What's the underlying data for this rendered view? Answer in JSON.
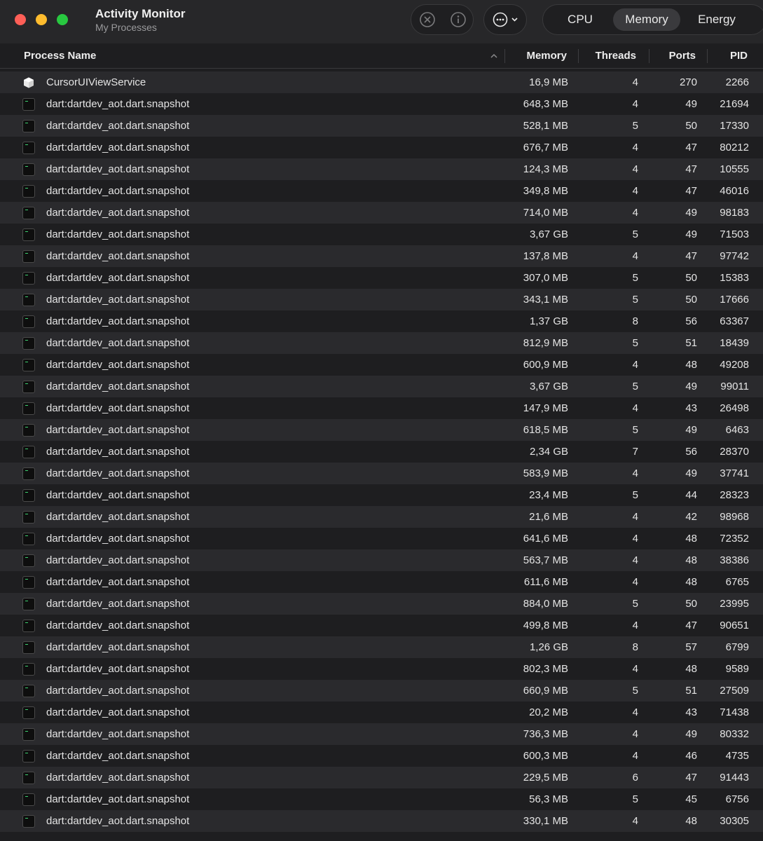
{
  "window": {
    "title": "Activity Monitor",
    "subtitle": "My Processes"
  },
  "toolbar": {
    "tabs": [
      "CPU",
      "Memory",
      "Energy"
    ],
    "selected_tab": "Memory",
    "stop_icon": "stop-process-icon",
    "info_icon": "info-icon",
    "more_icon": "more-options-icon"
  },
  "columns": {
    "name": "Process Name",
    "memory": "Memory",
    "threads": "Threads",
    "ports": "Ports",
    "pid": "PID"
  },
  "processes": [
    {
      "name": "CursorUIViewService",
      "memory": "16,9 MB",
      "threads": "4",
      "ports": "270",
      "pid": "2266",
      "icon": "cube-icon"
    },
    {
      "name": "dart:dartdev_aot.dart.snapshot",
      "memory": "648,3 MB",
      "threads": "4",
      "ports": "49",
      "pid": "21694",
      "icon": "terminal-icon"
    },
    {
      "name": "dart:dartdev_aot.dart.snapshot",
      "memory": "528,1 MB",
      "threads": "5",
      "ports": "50",
      "pid": "17330",
      "icon": "terminal-icon"
    },
    {
      "name": "dart:dartdev_aot.dart.snapshot",
      "memory": "676,7 MB",
      "threads": "4",
      "ports": "47",
      "pid": "80212",
      "icon": "terminal-icon"
    },
    {
      "name": "dart:dartdev_aot.dart.snapshot",
      "memory": "124,3 MB",
      "threads": "4",
      "ports": "47",
      "pid": "10555",
      "icon": "terminal-icon"
    },
    {
      "name": "dart:dartdev_aot.dart.snapshot",
      "memory": "349,8 MB",
      "threads": "4",
      "ports": "47",
      "pid": "46016",
      "icon": "terminal-icon"
    },
    {
      "name": "dart:dartdev_aot.dart.snapshot",
      "memory": "714,0 MB",
      "threads": "4",
      "ports": "49",
      "pid": "98183",
      "icon": "terminal-icon"
    },
    {
      "name": "dart:dartdev_aot.dart.snapshot",
      "memory": "3,67 GB",
      "threads": "5",
      "ports": "49",
      "pid": "71503",
      "icon": "terminal-icon"
    },
    {
      "name": "dart:dartdev_aot.dart.snapshot",
      "memory": "137,8 MB",
      "threads": "4",
      "ports": "47",
      "pid": "97742",
      "icon": "terminal-icon"
    },
    {
      "name": "dart:dartdev_aot.dart.snapshot",
      "memory": "307,0 MB",
      "threads": "5",
      "ports": "50",
      "pid": "15383",
      "icon": "terminal-icon"
    },
    {
      "name": "dart:dartdev_aot.dart.snapshot",
      "memory": "343,1 MB",
      "threads": "5",
      "ports": "50",
      "pid": "17666",
      "icon": "terminal-icon"
    },
    {
      "name": "dart:dartdev_aot.dart.snapshot",
      "memory": "1,37 GB",
      "threads": "8",
      "ports": "56",
      "pid": "63367",
      "icon": "terminal-icon"
    },
    {
      "name": "dart:dartdev_aot.dart.snapshot",
      "memory": "812,9 MB",
      "threads": "5",
      "ports": "51",
      "pid": "18439",
      "icon": "terminal-icon"
    },
    {
      "name": "dart:dartdev_aot.dart.snapshot",
      "memory": "600,9 MB",
      "threads": "4",
      "ports": "48",
      "pid": "49208",
      "icon": "terminal-icon"
    },
    {
      "name": "dart:dartdev_aot.dart.snapshot",
      "memory": "3,67 GB",
      "threads": "5",
      "ports": "49",
      "pid": "99011",
      "icon": "terminal-icon"
    },
    {
      "name": "dart:dartdev_aot.dart.snapshot",
      "memory": "147,9 MB",
      "threads": "4",
      "ports": "43",
      "pid": "26498",
      "icon": "terminal-icon"
    },
    {
      "name": "dart:dartdev_aot.dart.snapshot",
      "memory": "618,5 MB",
      "threads": "5",
      "ports": "49",
      "pid": "6463",
      "icon": "terminal-icon"
    },
    {
      "name": "dart:dartdev_aot.dart.snapshot",
      "memory": "2,34 GB",
      "threads": "7",
      "ports": "56",
      "pid": "28370",
      "icon": "terminal-icon"
    },
    {
      "name": "dart:dartdev_aot.dart.snapshot",
      "memory": "583,9 MB",
      "threads": "4",
      "ports": "49",
      "pid": "37741",
      "icon": "terminal-icon"
    },
    {
      "name": "dart:dartdev_aot.dart.snapshot",
      "memory": "23,4 MB",
      "threads": "5",
      "ports": "44",
      "pid": "28323",
      "icon": "terminal-icon"
    },
    {
      "name": "dart:dartdev_aot.dart.snapshot",
      "memory": "21,6 MB",
      "threads": "4",
      "ports": "42",
      "pid": "98968",
      "icon": "terminal-icon"
    },
    {
      "name": "dart:dartdev_aot.dart.snapshot",
      "memory": "641,6 MB",
      "threads": "4",
      "ports": "48",
      "pid": "72352",
      "icon": "terminal-icon"
    },
    {
      "name": "dart:dartdev_aot.dart.snapshot",
      "memory": "563,7 MB",
      "threads": "4",
      "ports": "48",
      "pid": "38386",
      "icon": "terminal-icon"
    },
    {
      "name": "dart:dartdev_aot.dart.snapshot",
      "memory": "611,6 MB",
      "threads": "4",
      "ports": "48",
      "pid": "6765",
      "icon": "terminal-icon"
    },
    {
      "name": "dart:dartdev_aot.dart.snapshot",
      "memory": "884,0 MB",
      "threads": "5",
      "ports": "50",
      "pid": "23995",
      "icon": "terminal-icon"
    },
    {
      "name": "dart:dartdev_aot.dart.snapshot",
      "memory": "499,8 MB",
      "threads": "4",
      "ports": "47",
      "pid": "90651",
      "icon": "terminal-icon"
    },
    {
      "name": "dart:dartdev_aot.dart.snapshot",
      "memory": "1,26 GB",
      "threads": "8",
      "ports": "57",
      "pid": "6799",
      "icon": "terminal-icon"
    },
    {
      "name": "dart:dartdev_aot.dart.snapshot",
      "memory": "802,3 MB",
      "threads": "4",
      "ports": "48",
      "pid": "9589",
      "icon": "terminal-icon"
    },
    {
      "name": "dart:dartdev_aot.dart.snapshot",
      "memory": "660,9 MB",
      "threads": "5",
      "ports": "51",
      "pid": "27509",
      "icon": "terminal-icon"
    },
    {
      "name": "dart:dartdev_aot.dart.snapshot",
      "memory": "20,2 MB",
      "threads": "4",
      "ports": "43",
      "pid": "71438",
      "icon": "terminal-icon"
    },
    {
      "name": "dart:dartdev_aot.dart.snapshot",
      "memory": "736,3 MB",
      "threads": "4",
      "ports": "49",
      "pid": "80332",
      "icon": "terminal-icon"
    },
    {
      "name": "dart:dartdev_aot.dart.snapshot",
      "memory": "600,3 MB",
      "threads": "4",
      "ports": "46",
      "pid": "4735",
      "icon": "terminal-icon"
    },
    {
      "name": "dart:dartdev_aot.dart.snapshot",
      "memory": "229,5 MB",
      "threads": "6",
      "ports": "47",
      "pid": "91443",
      "icon": "terminal-icon"
    },
    {
      "name": "dart:dartdev_aot.dart.snapshot",
      "memory": "56,3 MB",
      "threads": "5",
      "ports": "45",
      "pid": "6756",
      "icon": "terminal-icon"
    },
    {
      "name": "dart:dartdev_aot.dart.snapshot",
      "memory": "330,1 MB",
      "threads": "4",
      "ports": "48",
      "pid": "30305",
      "icon": "terminal-icon"
    }
  ]
}
